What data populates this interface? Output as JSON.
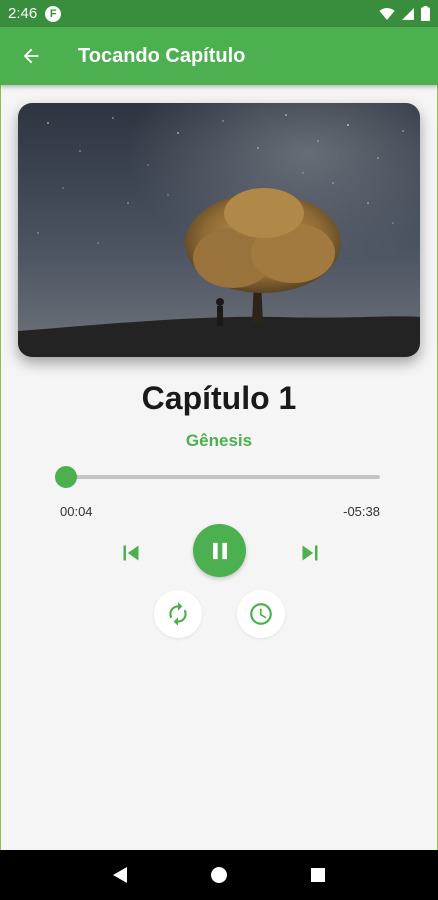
{
  "status_bar": {
    "time": "2:46",
    "app_icon": "F",
    "icons": [
      "wifi-icon",
      "signal-icon",
      "battery-icon"
    ]
  },
  "app_bar": {
    "title": "Tocando Capítulo",
    "back_icon": "arrow-left-icon",
    "bg_color": "#4caf50"
  },
  "cover": {
    "image": "night-sky-tree"
  },
  "track": {
    "title": "Capítulo 1",
    "subtitle": "Gênesis"
  },
  "progress": {
    "elapsed": "00:04",
    "remaining": "-05:38",
    "fraction": 0.012
  },
  "controls": {
    "prev_icon": "skip-previous-icon",
    "play_icon": "pause-icon",
    "next_icon": "skip-next-icon",
    "repeat_icon": "repeat-icon",
    "timer_icon": "clock-icon"
  },
  "nav_bar": {
    "icons": [
      "back-triangle-icon",
      "home-circle-icon",
      "recents-square-icon"
    ]
  },
  "colors": {
    "accent": "#4caf50",
    "status": "#388e3c"
  }
}
